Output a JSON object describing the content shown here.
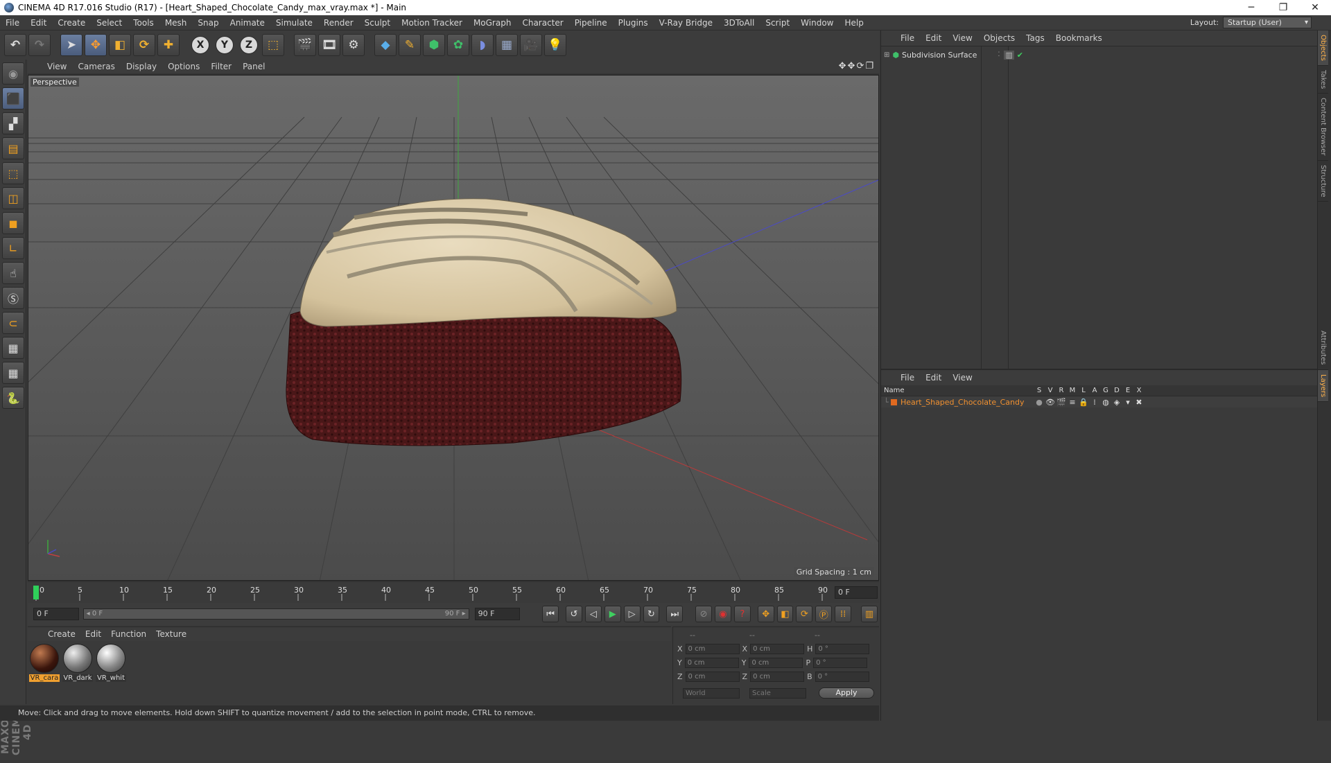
{
  "titlebar": {
    "title": "CINEMA 4D R17.016 Studio (R17) - [Heart_Shaped_Chocolate_Candy_max_vray.max *] - Main",
    "min": "─",
    "restore": "❐",
    "close": "✕"
  },
  "menubar": {
    "items": [
      "File",
      "Edit",
      "Create",
      "Select",
      "Tools",
      "Mesh",
      "Snap",
      "Animate",
      "Simulate",
      "Render",
      "Sculpt",
      "Motion Tracker",
      "MoGraph",
      "Character",
      "Pipeline",
      "Plugins",
      "V-Ray Bridge",
      "3DToAll",
      "Script",
      "Window",
      "Help"
    ],
    "layout_label": "Layout:",
    "layout_value": "Startup (User)"
  },
  "viewport": {
    "menu": [
      "View",
      "Cameras",
      "Display",
      "Options",
      "Filter",
      "Panel"
    ],
    "label": "Perspective",
    "grid_spacing": "Grid Spacing : 1 cm",
    "nav_icons": "✥✥⟳❐"
  },
  "timeline": {
    "ticks": [
      "0",
      "5",
      "10",
      "15",
      "20",
      "25",
      "30",
      "35",
      "40",
      "45",
      "50",
      "55",
      "60",
      "65",
      "70",
      "75",
      "80",
      "85",
      "90"
    ],
    "frame_field": "0 F"
  },
  "transport": {
    "start_field": "0 F",
    "range_left": "◂ 0 F",
    "range_right": "90 F ▸",
    "end_field": "90 F"
  },
  "materials": {
    "menu": [
      "Create",
      "Edit",
      "Function",
      "Texture"
    ],
    "items": [
      {
        "label": "VR_cara"
      },
      {
        "label": "VR_dark"
      },
      {
        "label": "VR_whit"
      }
    ]
  },
  "coords": {
    "header": [
      "--",
      "--",
      "--"
    ],
    "rows": [
      {
        "a": "X",
        "av": "0 cm",
        "b": "X",
        "bv": "0 cm",
        "c": "H",
        "cv": "0 °"
      },
      {
        "a": "Y",
        "av": "0 cm",
        "b": "Y",
        "bv": "0 cm",
        "c": "P",
        "cv": "0 °"
      },
      {
        "a": "Z",
        "av": "0 cm",
        "b": "Z",
        "bv": "0 cm",
        "c": "B",
        "cv": "0 °"
      }
    ],
    "world": "World",
    "scale": "Scale",
    "apply": "Apply"
  },
  "status": {
    "text": "Move: Click and drag to move elements. Hold down SHIFT to quantize movement / add to the selection in point mode, CTRL to remove."
  },
  "objects": {
    "menu": [
      "File",
      "Edit",
      "View",
      "Objects",
      "Tags",
      "Bookmarks"
    ],
    "row_label": "Subdivision Surface"
  },
  "layers": {
    "menu": [
      "File",
      "Edit",
      "View"
    ],
    "name_header": "Name",
    "cols": [
      "S",
      "V",
      "R",
      "M",
      "L",
      "A",
      "G",
      "D",
      "E",
      "X"
    ],
    "row_label": "Heart_Shaped_Chocolate_Candy"
  },
  "sidetabs": [
    "Objects",
    "Takes",
    "Content Browser",
    "Structure",
    "Attributes",
    "Layers"
  ],
  "brand": "MAXON CINEMA 4D"
}
